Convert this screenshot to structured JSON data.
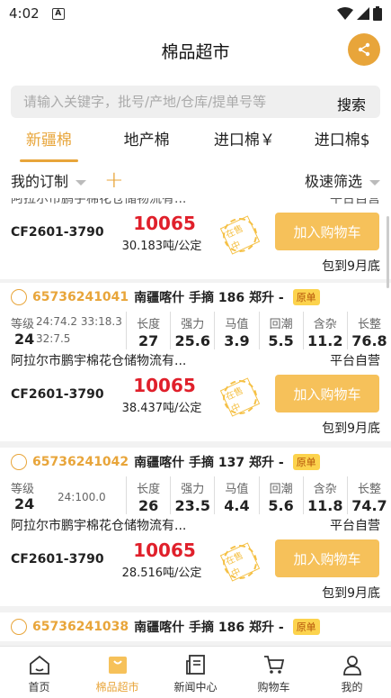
{
  "status": {
    "time": "4:02",
    "a_label": "A"
  },
  "header": {
    "title": "棉品超市"
  },
  "search": {
    "placeholder": "请输入关键字，批号/产地/仓库/提单号等",
    "button": "搜索"
  },
  "tabs": [
    {
      "label": "新疆棉",
      "active": true
    },
    {
      "label": "地产棉",
      "active": false
    },
    {
      "label": "进口棉￥",
      "active": false
    },
    {
      "label": "进口棉$",
      "active": false
    }
  ],
  "filter": {
    "my_order": "我的订制",
    "plus": "+",
    "quick": "极速筛选"
  },
  "partial_top": {
    "seller_cut": "阿拉尔市鹏宇棉花仓储物流有...",
    "platform": "平台自营",
    "contract": "CF2601-3790",
    "price": "10065",
    "qty": "30.183吨/公定",
    "cart": "加入购物车",
    "delivery": "包到9月底"
  },
  "cards": [
    {
      "batch": "65736241041",
      "origin": "南疆喀什 手摘 186 郑升 -",
      "badge": "原单",
      "grade_label": "等级",
      "grade_extra1": "24:74.2 33:18.3",
      "grade_value": "24",
      "grade_extra2": "32:7.5",
      "specs": [
        {
          "label": "长度",
          "value": "27"
        },
        {
          "label": "强力",
          "value": "25.6"
        },
        {
          "label": "马值",
          "value": "3.9"
        },
        {
          "label": "回潮",
          "value": "5.5"
        },
        {
          "label": "含杂",
          "value": "11.2"
        },
        {
          "label": "长整",
          "value": "76.8"
        }
      ],
      "seller": "阿拉尔市鹏宇棉花仓储物流有...",
      "platform": "平台自营",
      "contract": "CF2601-3790",
      "price": "10065",
      "qty": "38.437吨/公定",
      "cart": "加入购物车",
      "delivery": "包到9月底"
    },
    {
      "batch": "65736241042",
      "origin": "南疆喀什 手摘 137 郑升 -",
      "badge": "原单",
      "grade_label": "等级",
      "grade_extra1": "",
      "grade_value": "24",
      "grade_extra2": "24:100.0",
      "specs": [
        {
          "label": "长度",
          "value": "26"
        },
        {
          "label": "强力",
          "value": "23.5"
        },
        {
          "label": "马值",
          "value": "4.4"
        },
        {
          "label": "回潮",
          "value": "5.6"
        },
        {
          "label": "含杂",
          "value": "11.8"
        },
        {
          "label": "长整",
          "value": "74.7"
        }
      ],
      "seller": "阿拉尔市鹏宇棉花仓储物流有...",
      "platform": "平台自营",
      "contract": "CF2601-3790",
      "price": "10065",
      "qty": "28.516吨/公定",
      "cart": "加入购物车",
      "delivery": "包到9月底"
    },
    {
      "batch": "65736241038",
      "origin": "南疆喀什 手摘 186 郑升 -",
      "badge": "原单"
    }
  ],
  "stamp_text": "在售中",
  "nav": [
    {
      "label": "首页",
      "icon": "home-icon",
      "active": false
    },
    {
      "label": "棉品超市",
      "icon": "shopping-bag-icon",
      "active": true
    },
    {
      "label": "新闻中心",
      "icon": "news-icon",
      "active": false
    },
    {
      "label": "购物车",
      "icon": "cart-icon",
      "active": false
    },
    {
      "label": "我的",
      "icon": "user-icon",
      "active": false
    }
  ],
  "colors": {
    "accent": "#e8a53a",
    "price": "#e0202b",
    "button": "#f6c15a",
    "badge": "#fcd34d"
  }
}
